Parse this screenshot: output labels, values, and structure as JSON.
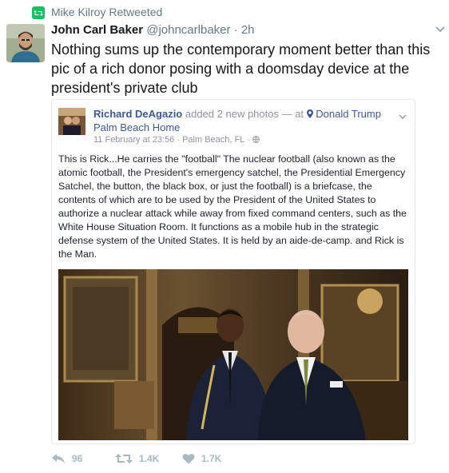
{
  "retweet": {
    "label": "Mike Kilroy Retweeted",
    "icon": "retweet-icon",
    "color": "#17bf63"
  },
  "tweet": {
    "author_name": "John Carl Baker",
    "author_handle": "@johncarlbaker",
    "separator": "·",
    "time": "2h",
    "text": "Nothing sums up the contemporary moment better than this pic of a rich donor posing with a doomsday device at the president's private club"
  },
  "embed": {
    "poster": "Richard DeAgazio",
    "action": "added 2 new photos — at",
    "place": "Donald Trump Palm Beach Home",
    "meta": "11 February at 23:56 · Palm Beach, FL ·",
    "body": "This is Rick...He carries the \"football\" The nuclear football (also known as the atomic football, the President's emergency satchel, the Presidential Emergency Satchel, the button, the black box, or just the football) is a briefcase, the contents of which are to be used by the President of the United States to authorize a nuclear attack while away from fixed command centers, such as the White House Situation Room. It functions as a mobile hub in the strategic defense system of the United States. It is held by an aide-de-camp. and Rick is the Man.",
    "link_color": "#3b5998"
  },
  "actions": {
    "reply_count": "96",
    "retweet_count": "1.4K",
    "like_count": "1.7K",
    "color": "#aab8c2"
  }
}
